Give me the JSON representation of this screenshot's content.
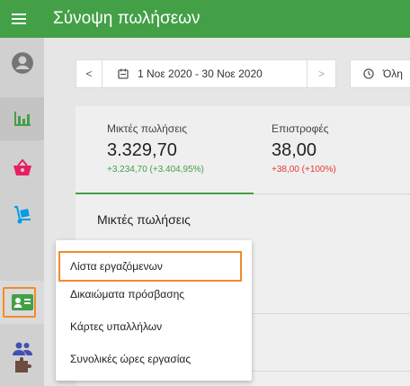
{
  "header": {
    "title": "Σύνοψη πωλήσεων",
    "menu_icon": "hamburger-icon",
    "color": "#43a047"
  },
  "sidebar": {
    "items": [
      {
        "name": "account-icon",
        "color": "#757575"
      },
      {
        "name": "bar-chart-icon",
        "color": "#43a047"
      },
      {
        "name": "basket-icon",
        "color": "#e91e63"
      },
      {
        "name": "dolly-icon",
        "color": "#039be5"
      },
      {
        "name": "employee-badge-icon",
        "color": "#43a047"
      },
      {
        "name": "customers-icon",
        "color": "#3f51b5"
      },
      {
        "name": "puzzle-icon",
        "color": "#6d4c41"
      }
    ]
  },
  "toolbar": {
    "prev_label": "<",
    "date_range": "1 Νοε 2020 - 30 Νοε 2020",
    "next_label": ">",
    "time_label": "Όλη"
  },
  "stats": [
    {
      "label": "Μικτές πωλήσεις",
      "value": "3.329,70",
      "change": "+3.234,70 (+3.404,95%)"
    },
    {
      "label": "Επιστροφές",
      "value": "38,00",
      "change": "+38,00 (+100%)"
    }
  ],
  "section": {
    "title": "Μικτές πωλήσεις"
  },
  "dropdown": {
    "items": [
      "Λίστα εργαζόμενων",
      "Δικαιώματα πρόσβασης",
      "Κάρτες υπαλλήλων",
      "Συνολικές ώρες εργασίας"
    ]
  },
  "colors": {
    "accent": "#43a047",
    "highlight": "#f28c28",
    "negative": "#e53935"
  }
}
